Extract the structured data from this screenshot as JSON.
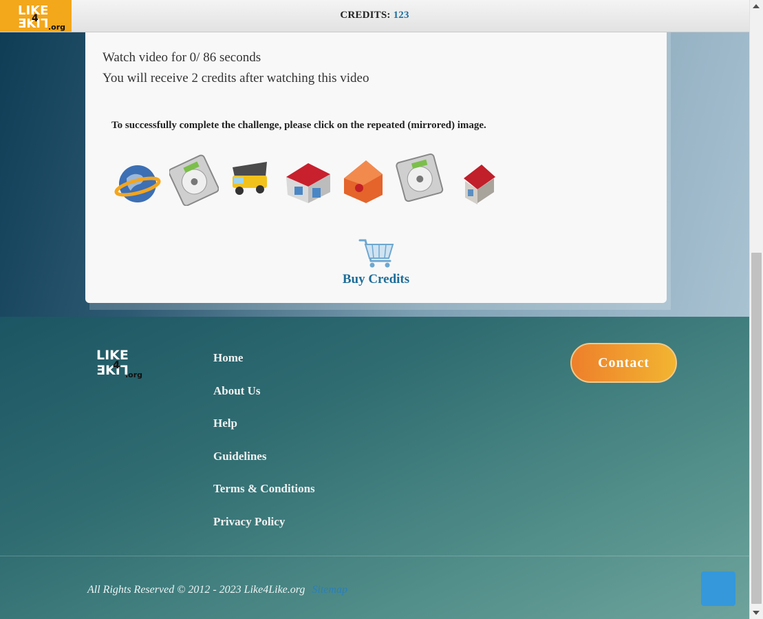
{
  "header": {
    "logo_icon": "like4like-logo",
    "credits_label": "CREDITS:",
    "credits_value": "123"
  },
  "video": {
    "watch_text": "Watch video for 0/ 86 seconds",
    "receive_text": "You will receive 2 credits after watching this video"
  },
  "challenge": {
    "instruction": "To successfully complete the challenge, please click on the repeated (mirrored) image.",
    "images": [
      "globe-icon",
      "hard-drive-icon",
      "dump-truck-icon",
      "shop-icon",
      "tag-icon",
      "hard-drive-icon",
      "house-icon"
    ]
  },
  "buy": {
    "icon": "cart-icon",
    "label": "Buy Credits"
  },
  "footer": {
    "links": [
      "Home",
      "About Us",
      "Help",
      "Guidelines",
      "Terms & Conditions",
      "Privacy Policy"
    ],
    "contact_label": "Contact",
    "copyright": "All Rights Reserved © 2012 - 2023 Like4Like.org",
    "sitemap": "Sitemap",
    "back_to_top_color": "#3498db"
  }
}
